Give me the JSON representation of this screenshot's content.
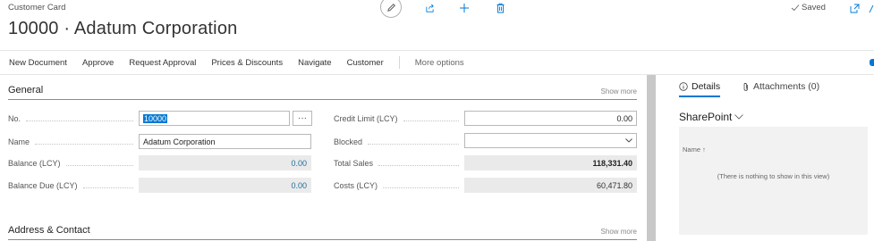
{
  "header": {
    "breadcrumb": "Customer Card",
    "title": "10000 · Adatum Corporation",
    "saved": "Saved",
    "icons": [
      "pencil-icon",
      "share-icon",
      "plus-icon",
      "trash-icon",
      "checkmark-icon",
      "open-new-window-icon"
    ]
  },
  "actions": {
    "items": [
      "New Document",
      "Approve",
      "Request Approval",
      "Prices & Discounts",
      "Navigate",
      "Customer"
    ],
    "more": "More options"
  },
  "general": {
    "title": "General",
    "show_more": "Show more",
    "no_label": "No.",
    "no_value": "10000",
    "name_label": "Name",
    "name_value": "Adatum Corporation",
    "balance_label": "Balance (LCY)",
    "balance_value": "0.00",
    "balance_due_label": "Balance Due (LCY)",
    "balance_due_value": "0.00",
    "credit_limit_label": "Credit Limit (LCY)",
    "credit_limit_value": "0.00",
    "blocked_label": "Blocked",
    "blocked_value": "",
    "total_sales_label": "Total Sales",
    "total_sales_value": "118,331.40",
    "costs_label": "Costs (LCY)",
    "costs_value": "60,471.80",
    "assist_button": "···"
  },
  "address": {
    "title": "Address & Contact",
    "show_more": "Show more"
  },
  "factbox": {
    "tab_details": "Details",
    "tab_attachments": "Attachments (0)",
    "sharepoint_title": "SharePoint",
    "column_name": "Name",
    "empty_text": "(There is nothing to show in this view)"
  },
  "colors": {
    "accent": "#0078d4",
    "link_value": "#1f6f9a",
    "readonly_bg": "#eaeaea"
  }
}
